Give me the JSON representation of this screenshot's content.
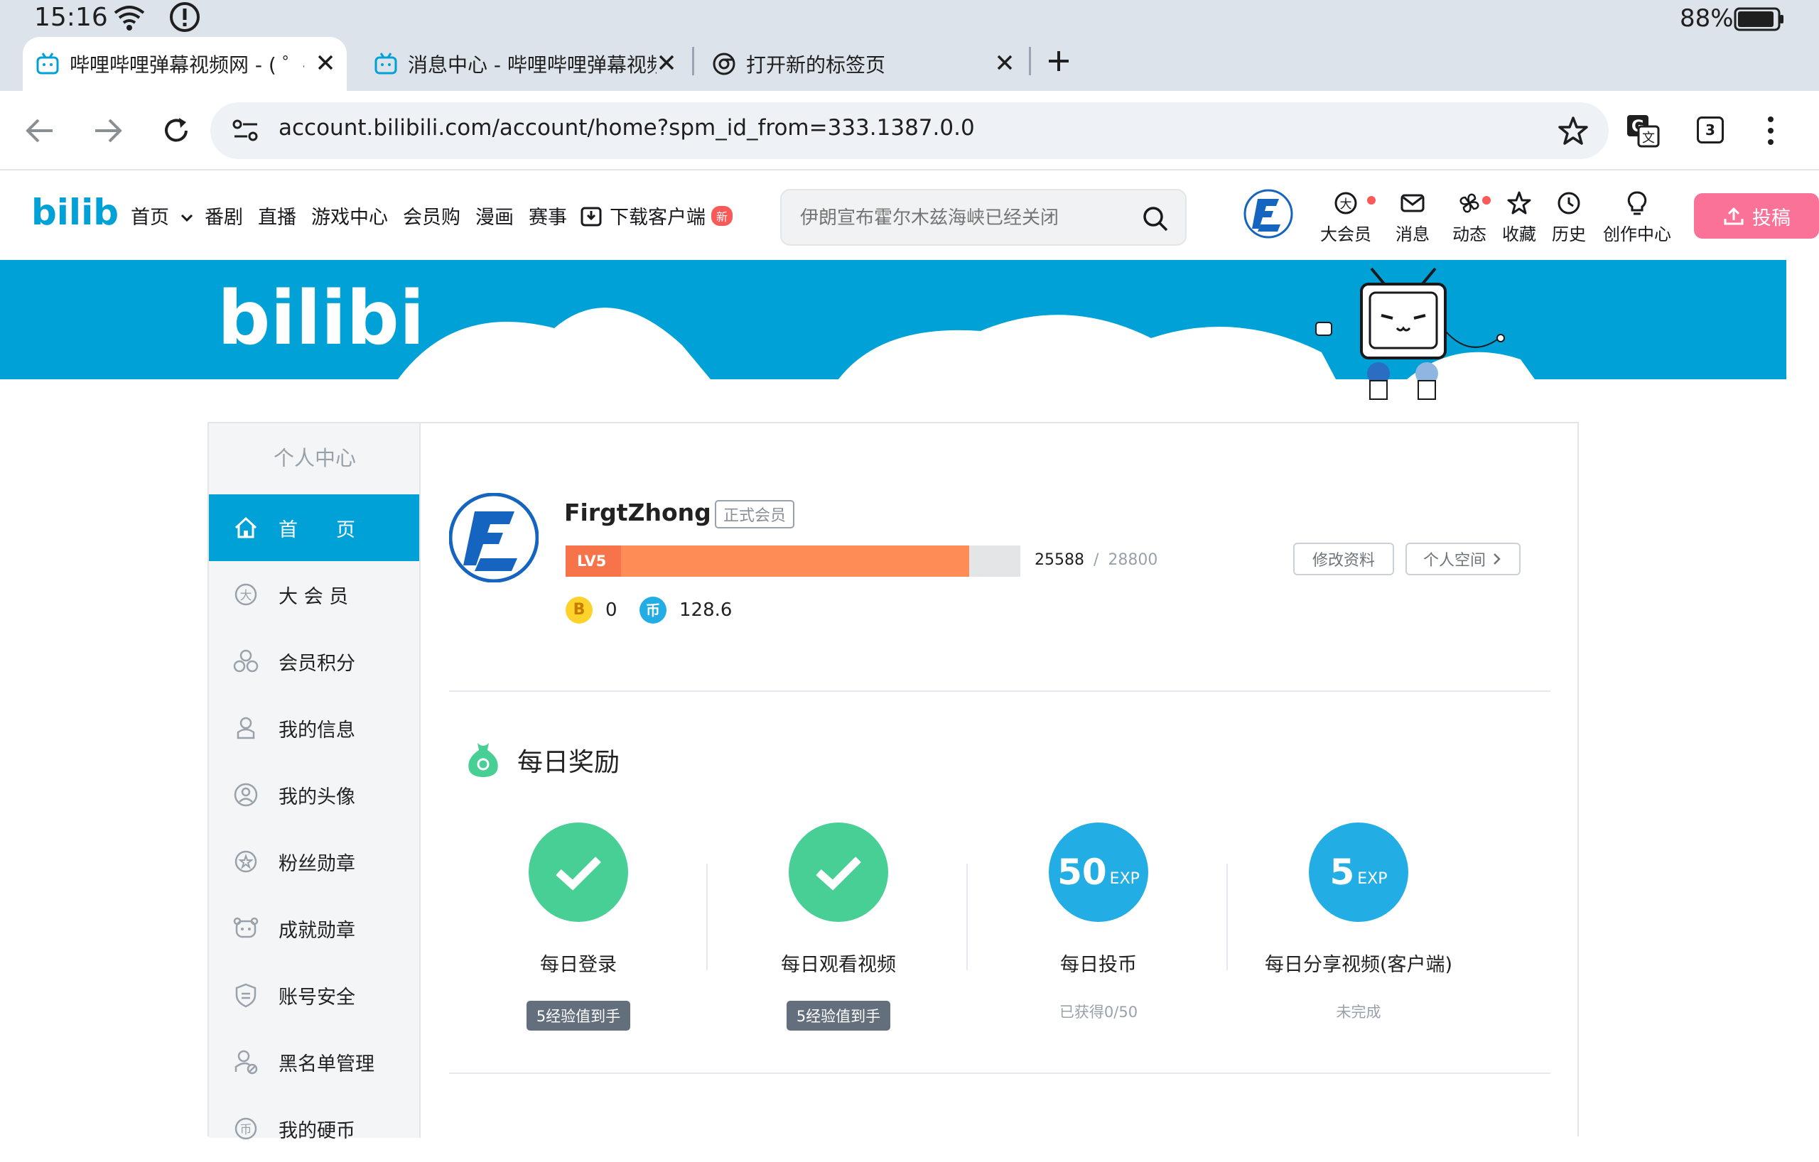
{
  "status_bar": {
    "time": "15:16",
    "battery": "88%"
  },
  "tabs": [
    {
      "title": "哔哩哔哩弹幕视频网 - ( ゜- ゜",
      "active": true
    },
    {
      "title": "消息中心 - 哔哩哔哩弹幕视频",
      "active": false
    },
    {
      "title": "打开新的标签页",
      "active": false
    }
  ],
  "address_bar": {
    "url": "account.bilibili.com/account/home?spm_id_from=333.1387.0.0",
    "tab_count": "3"
  },
  "header": {
    "logo": "bilibili",
    "nav": [
      "首页",
      "番剧",
      "直播",
      "游戏中心",
      "会员购",
      "漫画",
      "赛事",
      "下载客户端"
    ],
    "new_badge": "新",
    "search_placeholder": "伊朗宣布霍尔木兹海峡已经关闭",
    "actions": [
      "大会员",
      "消息",
      "动态",
      "收藏",
      "历史",
      "创作中心"
    ],
    "upload": "投稿"
  },
  "banner": {
    "logo": "bilibili"
  },
  "sidebar": {
    "title": "个人中心",
    "items": [
      "首　　页",
      "大 会 员",
      "会员积分",
      "我的信息",
      "我的头像",
      "粉丝勋章",
      "成就勋章",
      "账号安全",
      "黑名单管理",
      "我的硬币"
    ]
  },
  "profile": {
    "username": "FirgtZhong",
    "member_tag": "正式会员",
    "level": "LV5",
    "exp_current": "25588",
    "exp_sep": "/",
    "exp_total": "28800",
    "exp_progress": 0.888,
    "b_coin": "0",
    "coins": "128.6",
    "edit_btn": "修改资料",
    "space_btn": "个人空间"
  },
  "daily": {
    "title": "每日奖励",
    "items": [
      {
        "label": "每日登录",
        "status": "5经验值到手",
        "done": true
      },
      {
        "label": "每日观看视频",
        "status": "5经验值到手",
        "done": true
      },
      {
        "label": "每日投币",
        "status": "已获得0/50",
        "done": false,
        "exp": "50",
        "unit": "EXP"
      },
      {
        "label": "每日分享视频(客户端)",
        "status": "未完成",
        "done": false,
        "exp": "5",
        "unit": "EXP"
      }
    ]
  },
  "colors": {
    "bili_blue": "#00a1d6",
    "bili_pink": "#fb7299",
    "level_orange": "#fd8c56",
    "reward_green": "#48cf95"
  }
}
